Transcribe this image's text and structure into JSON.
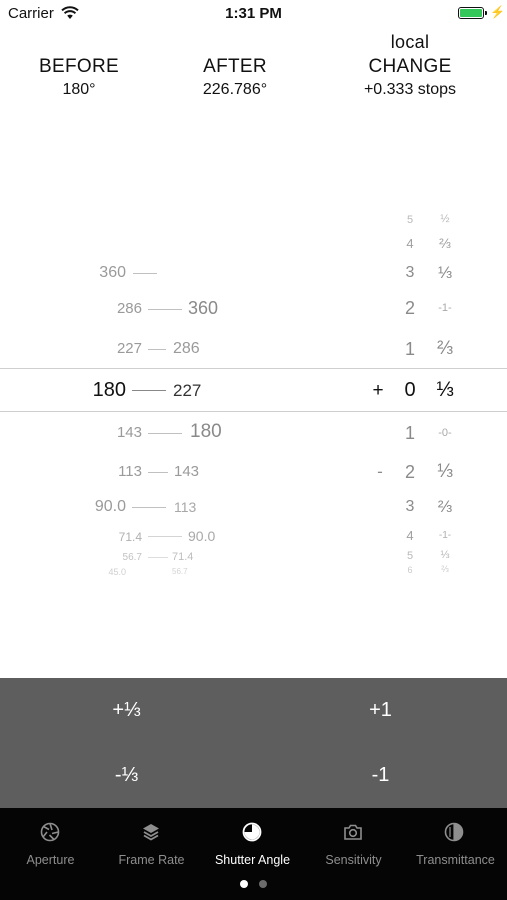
{
  "status_bar": {
    "carrier": "Carrier",
    "time": "1:31 PM"
  },
  "header": {
    "before_label": "BEFORE",
    "after_label": "AFTER",
    "change_label_top": "local",
    "change_label": "CHANGE",
    "before_value": "180°",
    "after_value": "226.786°",
    "change_value": "+0.333 stops"
  },
  "dial_left": {
    "before_values": [
      "360",
      "286",
      "227",
      "180",
      "143",
      "113",
      "90.0",
      "71.4",
      "56.7",
      "45.0"
    ],
    "after_values": [
      "360",
      "286",
      "227",
      "180",
      "143",
      "113",
      "90.0",
      "71.4",
      "56.7"
    ]
  },
  "dial_right": {
    "whole_stops": [
      "5",
      "4",
      "3",
      "2",
      "1",
      "0",
      "1",
      "2",
      "3",
      "4",
      "5",
      "6"
    ],
    "fractions": [
      "½",
      "⅔",
      "⅓",
      "-1-",
      "⅔",
      "⅓",
      "-0-",
      "⅓",
      "⅔",
      "-1-",
      "⅓",
      "⅔"
    ],
    "plus_sign": "+",
    "minus_sign": "-"
  },
  "buttons": {
    "plus_third": "+⅓",
    "plus_one": "+1",
    "minus_third": "-⅓",
    "minus_one": "-1"
  },
  "tabs": [
    {
      "label": "Aperture",
      "icon": "aperture-icon"
    },
    {
      "label": "Frame Rate",
      "icon": "layers-icon"
    },
    {
      "label": "Shutter Angle",
      "icon": "shutter-angle-icon"
    },
    {
      "label": "Sensitivity",
      "icon": "camera-icon"
    },
    {
      "label": "Transmittance",
      "icon": "half-circle-icon"
    }
  ],
  "page_indicator": {
    "count": 2,
    "current": 1
  },
  "colors": {
    "battery": "#34c759",
    "button_area": "#5e5e5e",
    "tab_bar": "#050505"
  }
}
